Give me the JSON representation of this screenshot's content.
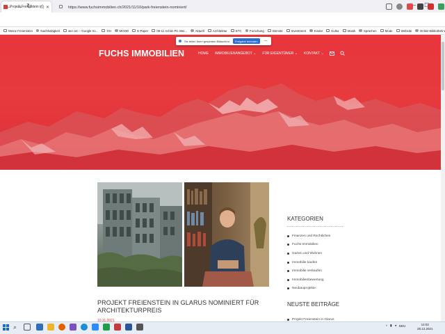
{
  "browser": {
    "tab_title": "Projekt Freienstein in Glarus n",
    "url": "https://www.fuchsimmobilien.ch/2021/11/10/park-freienstein-nominiert/",
    "bookmarks": [
      "Meine Freienstein",
      "Nachhaltigkeit",
      "wer arc – Google Sc...",
      "GH",
      "MOOD",
      "E-Paper",
      "09-11 Achim Pic Wei...",
      "Aktuell",
      "Architektur",
      "ETC",
      "Forschung",
      "Dienste",
      "Investment",
      "Kinder",
      "Kultur",
      "Musik",
      "Sprachen",
      "Mode",
      "Website",
      "Online-Bibliothek Wei..."
    ]
  },
  "share": {
    "message": "Sie teilen Ihren gesamten Bildschirm.",
    "stop_label": "Freigabe beenden",
    "minimize_label": "—"
  },
  "site": {
    "brand": "FUCHS IMMOBILIEN",
    "nav": [
      "HOME",
      "IMMOBILIENANGEBOT ⌄",
      "FÜR EIGENTÜMER ⌄",
      "KONTAKT ⌄"
    ],
    "hero_color": "#e8363b",
    "accent": "#e2363c"
  },
  "post": {
    "title": "PROJEKT FREIENSTEIN IN GLARUS NOMINIERT FÜR ARCHITEKTURPREIS",
    "date": "10.11.2021"
  },
  "sidebar": {
    "categories_heading": "KATEGORIEN",
    "categories": [
      "Finanzen und Rechtliches",
      "Fuchs Immobilien",
      "Garten und Wohnen",
      "Immobilie kaufen",
      "Immobilie verkaufen",
      "Immobilienbewertung",
      "Neubauprojekte"
    ],
    "recent_heading": "NEUSTE BEITRÄGE",
    "recent_first": "Projekt Freienstein in Glarus"
  },
  "taskbar": {
    "language": "DEU",
    "time": "14:02",
    "date": "28.12.2021"
  }
}
